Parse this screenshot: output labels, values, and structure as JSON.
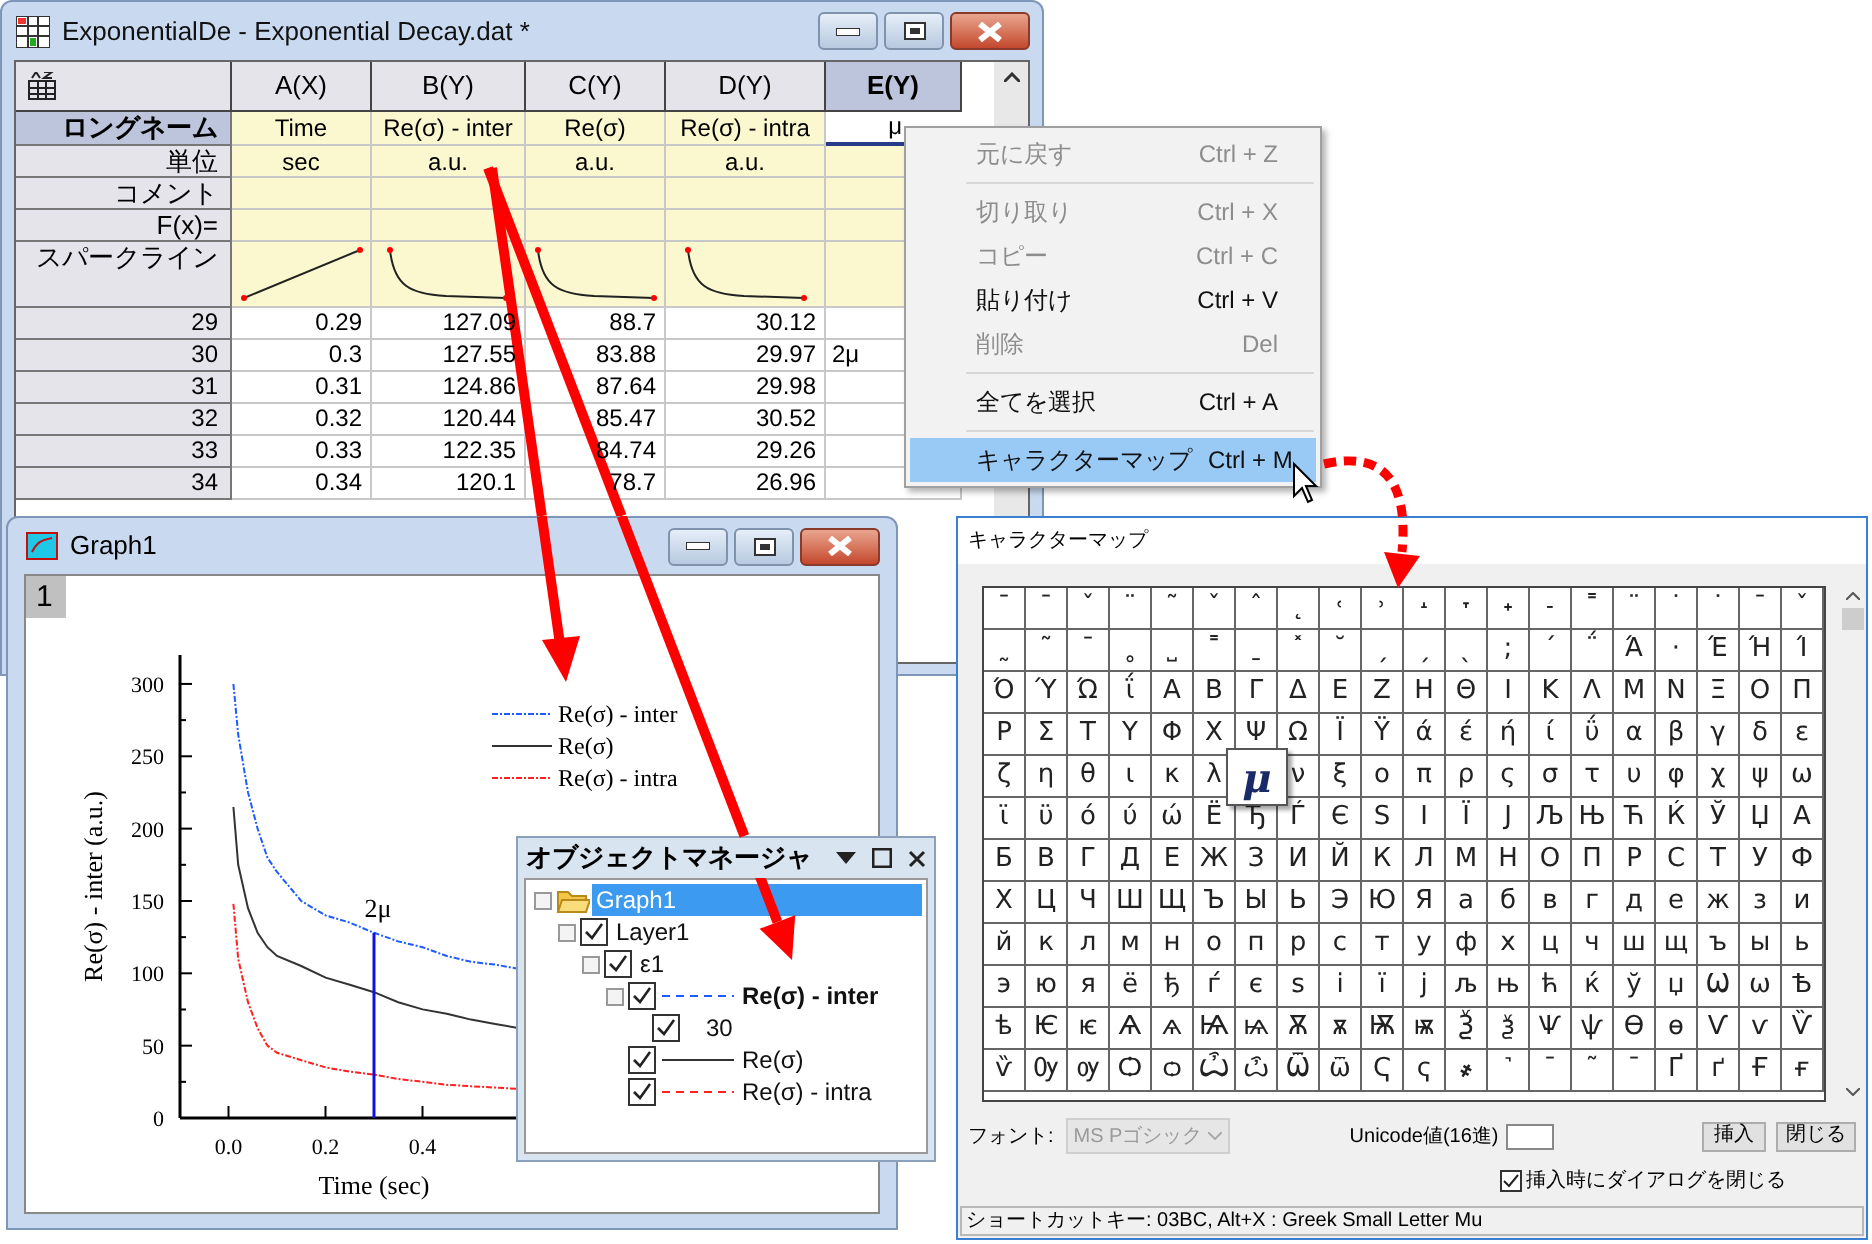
{
  "worksheet": {
    "title": "ExponentialDe - Exponential Decay.dat *",
    "columns": [
      {
        "label": "A(X)",
        "selected": false
      },
      {
        "label": "B(Y)",
        "selected": false
      },
      {
        "label": "C(Y)",
        "selected": false
      },
      {
        "label": "D(Y)",
        "selected": false
      },
      {
        "label": "E(Y)",
        "selected": true
      }
    ],
    "meta_rows": [
      {
        "label": "ロングネーム",
        "selected": true,
        "kind": "text",
        "cells": [
          "Time",
          "Re(σ) - inter",
          "Re(σ)",
          "Re(σ) - intra",
          "μ"
        ]
      },
      {
        "label": "単位",
        "selected": false,
        "kind": "text",
        "cells": [
          "sec",
          "a.u.",
          "a.u.",
          "a.u."
        ]
      },
      {
        "label": "コメント",
        "selected": false,
        "kind": "text"
      },
      {
        "label": "F(x)=",
        "selected": false,
        "kind": "text"
      },
      {
        "label": "スパークライン",
        "selected": false,
        "kind": "sparkline",
        "cells": [
          {
            "kind": "rising"
          },
          {
            "kind": "decay"
          },
          {
            "kind": "decay"
          },
          {
            "kind": "decay"
          }
        ]
      }
    ],
    "rows": [
      {
        "label": "29",
        "cells": [
          "0.29",
          "127.09",
          "88.7",
          "30.12"
        ]
      },
      {
        "label": "30",
        "cells": [
          "0.3",
          "127.55",
          "83.88",
          "29.97",
          "2μ"
        ]
      },
      {
        "label": "31",
        "cells": [
          "0.31",
          "124.86",
          "87.64",
          "29.98"
        ]
      },
      {
        "label": "32",
        "cells": [
          "0.32",
          "120.44",
          "85.47",
          "30.52"
        ]
      },
      {
        "label": "33",
        "cells": [
          "0.33",
          "122.35",
          "84.74",
          "29.26"
        ]
      },
      {
        "label": "34",
        "cells": [
          "0.34",
          "120.1",
          "78.7",
          "26.96"
        ]
      }
    ]
  },
  "context_menu": [
    {
      "kind": "item",
      "label": "元に戻す",
      "shortcut": "Ctrl + Z",
      "disabled": true,
      "selected": false
    },
    {
      "kind": "separator"
    },
    {
      "kind": "item",
      "label": "切り取り",
      "shortcut": "Ctrl + X",
      "disabled": true,
      "selected": false
    },
    {
      "kind": "item",
      "label": "コピー",
      "shortcut": "Ctrl + C",
      "disabled": true,
      "selected": false
    },
    {
      "kind": "item",
      "label": "貼り付け",
      "shortcut": "Ctrl + V",
      "disabled": false,
      "selected": false
    },
    {
      "kind": "item",
      "label": "削除",
      "shortcut": "Del",
      "disabled": true,
      "selected": false
    },
    {
      "kind": "separator"
    },
    {
      "kind": "item",
      "label": "全てを選択",
      "shortcut": "Ctrl + A",
      "disabled": false,
      "selected": false
    },
    {
      "kind": "separator"
    },
    {
      "kind": "item",
      "label": "キャラクターマップ",
      "shortcut": "Ctrl + M",
      "disabled": false,
      "selected": true
    }
  ],
  "graph": {
    "title": "Graph1",
    "layer": "1",
    "chart_data": {
      "type": "line",
      "xlabel": "Time (sec)",
      "ylabel": "Re(σ) - inter (a.u.)",
      "x": [
        0.01,
        0.02,
        0.04,
        0.06,
        0.08,
        0.1,
        0.15,
        0.2,
        0.25,
        0.3,
        0.35,
        0.4,
        0.45,
        0.5,
        0.55,
        0.6
      ],
      "series": [
        {
          "name": "Re(σ) - inter",
          "color": "#1f5cff",
          "line_style": "dashdot",
          "values": [
            300,
            265,
            225,
            200,
            180,
            170,
            150,
            140,
            135,
            128,
            122,
            118,
            112,
            108,
            106,
            103
          ]
        },
        {
          "name": "Re(σ)",
          "color": "#333333",
          "line_style": "solid",
          "values": [
            215,
            175,
            145,
            128,
            118,
            112,
            105,
            97,
            92,
            87,
            80,
            75,
            72,
            68,
            65,
            62
          ]
        },
        {
          "name": "Re(σ) - intra",
          "color": "#ff2020",
          "line_style": "dashdot",
          "values": [
            148,
            110,
            80,
            62,
            50,
            45,
            40,
            35,
            32,
            30,
            27,
            25,
            23,
            22,
            21,
            20
          ]
        }
      ],
      "legend": true,
      "xlim": [
        -0.1,
        0.62
      ],
      "ylim": [
        0,
        320
      ],
      "xticks": [
        {
          "value": 0,
          "label": "0.0"
        },
        {
          "value": 0.2,
          "label": "0.2"
        },
        {
          "value": 0.4,
          "label": "0.4"
        }
      ],
      "yticks": [
        0,
        50,
        100,
        150,
        200,
        250,
        300
      ],
      "annotations": [
        {
          "text": "2μ",
          "x": 0.3,
          "y": 128
        }
      ]
    }
  },
  "object_manager": {
    "title": "オブジェクトマネージャ",
    "tree": [
      {
        "label": "Graph1",
        "kind": "graph",
        "selected": true,
        "children": [
          {
            "label": "Layer1",
            "kind": "layer",
            "selected": false,
            "checked": true,
            "children": [
              {
                "label": "ε1",
                "kind": "layer",
                "selected": false,
                "checked": true,
                "children": [
                  {
                    "label": "Re(σ) - inter",
                    "kind": "plot",
                    "active": true,
                    "line": {
                      "kind": "dashed",
                      "color": "#1f5cff"
                    },
                    "selected": false,
                    "checked": true,
                    "children": [
                      {
                        "label": "30",
                        "kind": "label",
                        "selected": false,
                        "checked": true
                      }
                    ]
                  },
                  {
                    "label": "Re(σ)",
                    "kind": "plot",
                    "active": false,
                    "line": {
                      "kind": "solid",
                      "color": "#333333"
                    },
                    "selected": false,
                    "checked": true
                  },
                  {
                    "label": "Re(σ) - intra",
                    "kind": "plot",
                    "active": false,
                    "line": {
                      "kind": "dashed",
                      "color": "#ff2020"
                    },
                    "selected": false,
                    "checked": true
                  }
                ]
              }
            ]
          }
        ]
      }
    ]
  },
  "character_map": {
    "title": "キャラクターマップ",
    "rows": [
      [
        "ˉ",
        "¯",
        "ˇ",
        "¨",
        "˜",
        "ˇ",
        "ˆ",
        "˛",
        "˓",
        "˒",
        "˔",
        "˕",
        "˖",
        "˗",
        "˭",
        "¨",
        "˙",
        "˙",
        "ˉ",
        "ˇ"
      ],
      [
        "˷",
        "˜",
        "ˉ",
        "˳",
        "˽",
        "˭",
        "ˍ",
        "˟",
        "˘",
        "ˏ",
        "ˏ",
        "ˎ",
        ";",
        "΄",
        "΅",
        "Ά",
        "·",
        "Έ",
        "Ή",
        "Ί"
      ],
      [
        "Ό",
        "Ύ",
        "Ώ",
        "ΐ",
        "Α",
        "Β",
        "Γ",
        "Δ",
        "Ε",
        "Ζ",
        "Η",
        "Θ",
        "Ι",
        "Κ",
        "Λ",
        "Μ",
        "Ν",
        "Ξ",
        "Ο",
        "Π"
      ],
      [
        "Ρ",
        "Σ",
        "Τ",
        "Υ",
        "Φ",
        "Χ",
        "Ψ",
        "Ω",
        "Ϊ",
        "Ϋ",
        "ά",
        "έ",
        "ή",
        "ί",
        "ΰ",
        "α",
        "β",
        "γ",
        "δ",
        "ε"
      ],
      [
        "ζ",
        "η",
        "θ",
        "ι",
        "κ",
        "λ",
        {
          "char": "μ",
          "selected": true
        },
        "ν",
        "ξ",
        "ο",
        "π",
        "ρ",
        "ς",
        "σ",
        "τ",
        "υ",
        "φ",
        "χ",
        "ψ",
        "ω"
      ],
      [
        "ϊ",
        "ϋ",
        "ό",
        "ύ",
        "ώ",
        "Ё",
        "Ђ",
        "Ѓ",
        "Є",
        "Ѕ",
        "І",
        "Ї",
        "Ј",
        "Љ",
        "Њ",
        "Ћ",
        "Ќ",
        "Ў",
        "Џ",
        "А"
      ],
      [
        "Б",
        "В",
        "Г",
        "Д",
        "Е",
        "Ж",
        "З",
        "И",
        "Й",
        "К",
        "Л",
        "М",
        "Н",
        "О",
        "П",
        "Р",
        "С",
        "Т",
        "У",
        "Ф"
      ],
      [
        "Х",
        "Ц",
        "Ч",
        "Ш",
        "Щ",
        "Ъ",
        "Ы",
        "Ь",
        "Э",
        "Ю",
        "Я",
        "а",
        "б",
        "в",
        "г",
        "д",
        "е",
        "ж",
        "з",
        "и"
      ],
      [
        "й",
        "к",
        "л",
        "м",
        "н",
        "о",
        "п",
        "р",
        "с",
        "т",
        "у",
        "ф",
        "х",
        "ц",
        "ч",
        "ш",
        "щ",
        "ъ",
        "ы",
        "ь"
      ],
      [
        "э",
        "ю",
        "я",
        "ё",
        "ђ",
        "ѓ",
        "є",
        "ѕ",
        "і",
        "ї",
        "ј",
        "љ",
        "њ",
        "ћ",
        "ќ",
        "ў",
        "џ",
        "Ѡ",
        "ѡ",
        "Ѣ"
      ],
      [
        "ѣ",
        "Ѥ",
        "ѥ",
        "Ѧ",
        "ѧ",
        "Ѩ",
        "ѩ",
        "Ѫ",
        "ѫ",
        "Ѭ",
        "ѭ",
        "Ѯ",
        "ѯ",
        "Ѱ",
        "ѱ",
        "Ѳ",
        "ѳ",
        "Ѵ",
        "ѵ",
        "Ѷ"
      ],
      [
        "ѷ",
        "Ѹ",
        "ѹ",
        "Ѻ",
        "ѻ",
        "Ѽ",
        "ѽ",
        "Ѿ",
        "ѿ",
        "Ҁ",
        "ҁ",
        "҂",
        "˺",
        "¯",
        "˜",
        "ˉ",
        "Ґ",
        "ґ",
        "Ғ",
        "ғ"
      ]
    ],
    "font_label": "フォント:",
    "font": {
      "value": "MS Pゴシック",
      "disabled": true
    },
    "unicode_label": "Unicode値(16進)",
    "buttons": [
      "挿入",
      "閉じる"
    ],
    "close_on_insert": {
      "label": "挿入時にダイアログを閉じる",
      "checked": true
    },
    "status": "ショートカットキー: 03BC, Alt+X  : Greek Small Letter Mu"
  }
}
